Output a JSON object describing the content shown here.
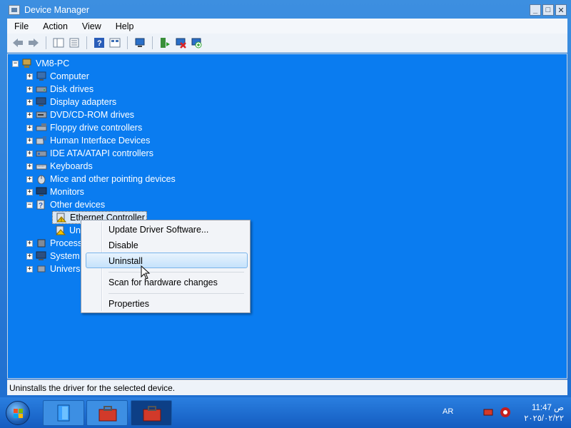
{
  "window": {
    "title": "Device Manager",
    "buttons": {
      "minimize": "_",
      "maximize": "□",
      "close": "✕"
    }
  },
  "menubar": [
    "File",
    "Action",
    "View",
    "Help"
  ],
  "tree": {
    "root": "VM8-PC",
    "categories": [
      {
        "label": "Computer",
        "expander": "+"
      },
      {
        "label": "Disk drives",
        "expander": "+"
      },
      {
        "label": "Display adapters",
        "expander": "+"
      },
      {
        "label": "DVD/CD-ROM drives",
        "expander": "+"
      },
      {
        "label": "Floppy drive controllers",
        "expander": "+"
      },
      {
        "label": "Human Interface Devices",
        "expander": "+"
      },
      {
        "label": "IDE ATA/ATAPI controllers",
        "expander": "+"
      },
      {
        "label": "Keyboards",
        "expander": "+"
      },
      {
        "label": "Mice and other pointing devices",
        "expander": "+"
      },
      {
        "label": "Monitors",
        "expander": "+"
      },
      {
        "label": "Other devices",
        "expander": "−"
      }
    ],
    "other_devices_children": [
      "Ethernet Controller",
      "Unk"
    ],
    "after_categories": [
      {
        "label": "Process",
        "expander": "+"
      },
      {
        "label": "System",
        "expander": "+"
      },
      {
        "label": "Univers",
        "expander": "+"
      }
    ]
  },
  "context_menu": {
    "items": [
      "Update Driver Software...",
      "Disable",
      "Uninstall",
      "Scan for hardware changes",
      "Properties"
    ],
    "highlighted": "Uninstall"
  },
  "statusbar": {
    "text": "Uninstalls the driver for the selected device."
  },
  "taskbar": {
    "language": "AR",
    "time": "ص 11:47",
    "date": "٢٠٢٥/٠٢/٢٢"
  },
  "colors": {
    "tree_bg": "#0a7cf0",
    "desktop": "#1a7ad8",
    "highlight_border": "#7ab4ea"
  }
}
